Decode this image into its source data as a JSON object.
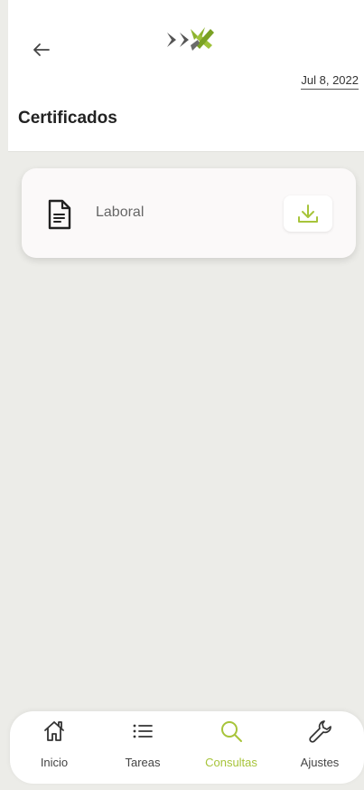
{
  "header": {
    "date": "Jul 8, 2022",
    "title": "Certificados"
  },
  "icons": {
    "back": "arrow-left-icon",
    "logo": "brand-logo",
    "document": "document-icon",
    "download": "download-icon"
  },
  "certificates": [
    {
      "label": "Laboral"
    }
  ],
  "nav": {
    "items": [
      {
        "label": "Inicio",
        "icon": "home-icon",
        "active": false
      },
      {
        "label": "Tareas",
        "icon": "list-icon",
        "active": false
      },
      {
        "label": "Consultas",
        "icon": "search-icon",
        "active": true
      },
      {
        "label": "Ajustes",
        "icon": "wrench-icon",
        "active": false
      }
    ]
  },
  "colors": {
    "accent": "#a7c43a",
    "background": "#ecece8",
    "card": "#fbf9f9",
    "text_dark": "#222222"
  }
}
